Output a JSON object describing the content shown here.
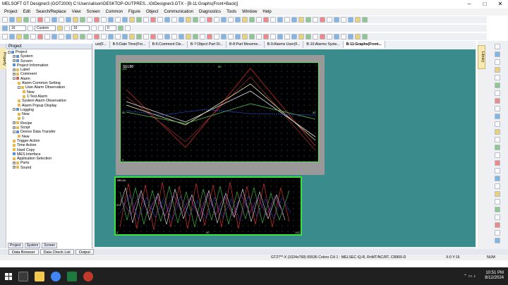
{
  "window": {
    "title": "MELSOFT GT Designer3 (GOT2000) C:\\Users\\alison\\DESKTOP-OUTPRES...\\GtDesigner3.GTX - [B-11:Graphs(Front+Back)]"
  },
  "menu": [
    "Project",
    "Edit",
    "Search/Replace",
    "View",
    "Screen",
    "Common",
    "Figure",
    "Object",
    "Communication",
    "Diagnostics",
    "Tools",
    "Window",
    "Help"
  ],
  "toolbar": {
    "font_size": "16",
    "zoom": "Custom",
    "line": "16",
    "count": "0"
  },
  "project_panel": {
    "title": "Project",
    "items": [
      {
        "label": "Project",
        "level": 0,
        "toggle": "-",
        "icon": "b"
      },
      {
        "label": "System",
        "level": 1,
        "toggle": "+",
        "icon": "b"
      },
      {
        "label": "Screen",
        "level": 1,
        "toggle": "+",
        "icon": "b"
      },
      {
        "label": "Project Information",
        "level": 1,
        "toggle": "",
        "icon": "b"
      },
      {
        "label": "Label",
        "level": 1,
        "toggle": "+",
        "icon": "y"
      },
      {
        "label": "Comment",
        "level": 1,
        "toggle": "+",
        "icon": "y"
      },
      {
        "label": "Alarm",
        "level": 1,
        "toggle": "-",
        "icon": "r"
      },
      {
        "label": "Alarm Common Setting",
        "level": 2,
        "toggle": "",
        "icon": "y"
      },
      {
        "label": "User Alarm Observation",
        "level": 2,
        "toggle": "-",
        "icon": "y"
      },
      {
        "label": "New",
        "level": 3,
        "toggle": "",
        "icon": "y"
      },
      {
        "label": "1:Test Alarm",
        "level": 3,
        "toggle": "",
        "icon": "y"
      },
      {
        "label": "System Alarm Observation",
        "level": 2,
        "toggle": "",
        "icon": "y"
      },
      {
        "label": "Alarm Popup Display",
        "level": 2,
        "toggle": "",
        "icon": "y"
      },
      {
        "label": "Logging",
        "level": 1,
        "toggle": "-",
        "icon": "b"
      },
      {
        "label": "New",
        "level": 2,
        "toggle": "",
        "icon": "y"
      },
      {
        "label": "1:",
        "level": 2,
        "toggle": "",
        "icon": "y"
      },
      {
        "label": "Recipe",
        "level": 1,
        "toggle": "+",
        "icon": "y"
      },
      {
        "label": "Script",
        "level": 1,
        "toggle": "+",
        "icon": "y"
      },
      {
        "label": "Device Data Transfer",
        "level": 1,
        "toggle": "-",
        "icon": "b"
      },
      {
        "label": "New",
        "level": 2,
        "toggle": "",
        "icon": "y"
      },
      {
        "label": "Trigger Action",
        "level": 1,
        "toggle": "",
        "icon": "y"
      },
      {
        "label": "Time Action",
        "level": 1,
        "toggle": "",
        "icon": "y"
      },
      {
        "label": "Hard Copy",
        "level": 1,
        "toggle": "",
        "icon": "y"
      },
      {
        "label": "MES Interface",
        "level": 1,
        "toggle": "",
        "icon": "b"
      },
      {
        "label": "Application Selection",
        "level": 1,
        "toggle": "",
        "icon": "y"
      },
      {
        "label": "Parts",
        "level": 1,
        "toggle": "+",
        "icon": "y"
      },
      {
        "label": "Sound",
        "level": 1,
        "toggle": "+",
        "icon": "y"
      }
    ],
    "tabs": [
      "Project",
      "System",
      "Screen"
    ]
  },
  "side_label": "Property",
  "library_label": "Library",
  "doc_tabs": [
    "ust(F...",
    "B-5:Date Time(Fro...",
    "B-6:Comment Dis...",
    "B-7:Object Part Di...",
    "B-8:Part Moveme...",
    "B-9:Alarms User(F...",
    "B-10:Alarms Syste...",
    "B-11:Graphs(Front..."
  ],
  "screen1": {
    "label": "SEL88",
    "left_ticks": [
      "100",
      "50",
      "0"
    ],
    "right_ticks": [
      "100",
      "50",
      "0"
    ],
    "top_tick": "50"
  },
  "screen2": {
    "label": "SEL04",
    "left_ticks": [
      "100",
      "50",
      "0"
    ],
    "bottom_ticks": [
      "0",
      "50",
      "100"
    ]
  },
  "bottom_tabs": [
    "Data Browser",
    "Data Check List",
    "Output"
  ],
  "status": {
    "left": "GT27**-X (1024x768)  65536 Colors  CH 1 : MELSEC iQ-R, RnMT/NC/RT, CR800-D",
    "mid": "0.0",
    "coords": "X:0 Y:15",
    "mode": "NUM"
  },
  "taskbar": {
    "time": "10:51 PM",
    "date": "8/12/2024"
  },
  "colors": {
    "canvas": "#3a8c8c",
    "screen_border": "#4cf04c"
  }
}
